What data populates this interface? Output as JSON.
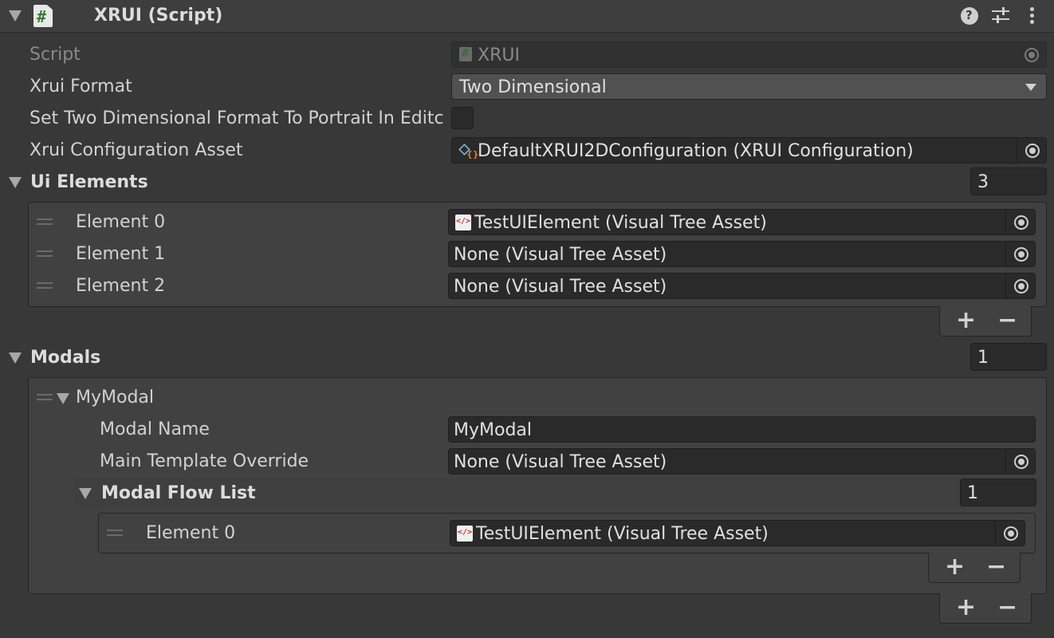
{
  "component": {
    "title": "XRUI (Script)"
  },
  "fields": {
    "script_label": "Script",
    "script_value": "XRUI",
    "format_label": "Xrui Format",
    "format_value": "Two Dimensional",
    "portrait_label": "Set Two Dimensional Format To Portrait In Editc",
    "config_label": "Xrui Configuration Asset",
    "config_value": "DefaultXRUI2DConfiguration (XRUI Configuration)"
  },
  "ui_elements": {
    "label": "Ui Elements",
    "count": "3",
    "items": [
      {
        "label": "Element 0",
        "value": "TestUIElement (Visual Tree Asset)"
      },
      {
        "label": "Element 1",
        "value": "None (Visual Tree Asset)"
      },
      {
        "label": "Element 2",
        "value": "None (Visual Tree Asset)"
      }
    ]
  },
  "modals": {
    "label": "Modals",
    "count": "1",
    "item_name": "MyModal",
    "modal_name_label": "Modal Name",
    "modal_name_value": "MyModal",
    "template_label": "Main Template Override",
    "template_value": "None (Visual Tree Asset)",
    "flow_list_label": "Modal Flow List",
    "flow_list_count": "1",
    "flow_items": [
      {
        "label": "Element 0",
        "value": "TestUIElement (Visual Tree Asset)"
      }
    ]
  },
  "controls": {
    "plus": "+",
    "minus": "−",
    "help": "?"
  }
}
